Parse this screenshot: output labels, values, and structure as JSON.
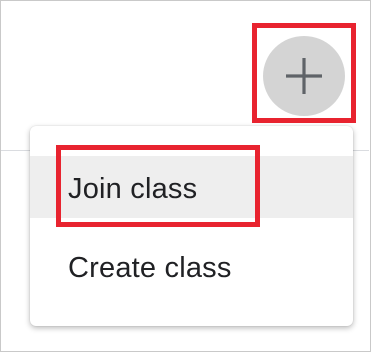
{
  "header": {
    "add_button_icon": "plus-icon",
    "add_button_icon_color": "#5f6368"
  },
  "menu": {
    "items": [
      {
        "label": "Join class"
      },
      {
        "label": "Create class"
      }
    ]
  },
  "colors": {
    "highlight": "#e8232f",
    "add_button_bg": "#d4d4d4",
    "hover_row": "#eeeeee"
  }
}
